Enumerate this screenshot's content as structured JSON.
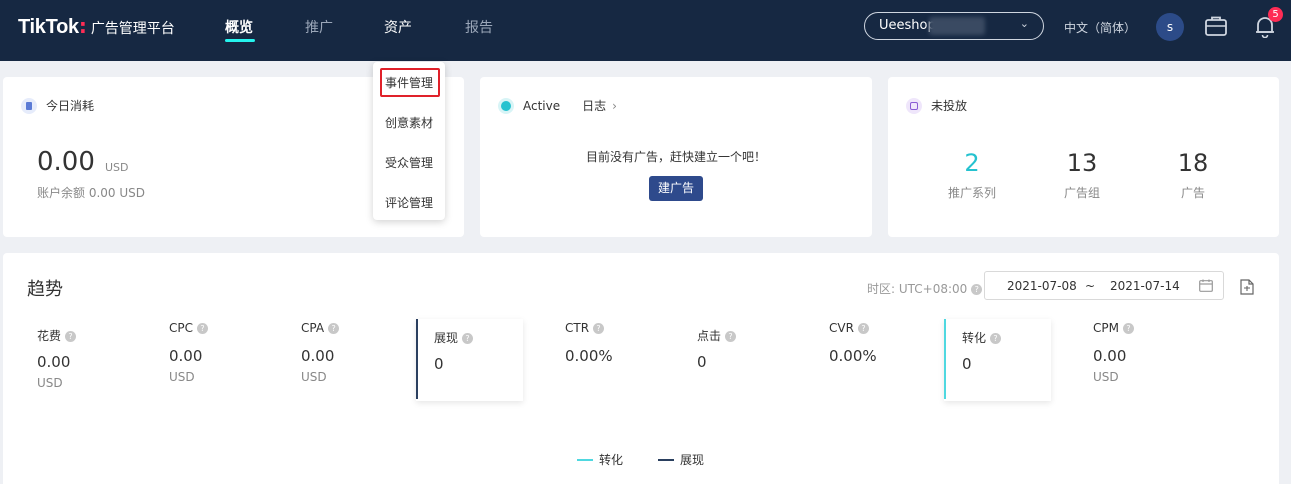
{
  "header": {
    "logo_main": "TikTok",
    "logo_colon": ":",
    "logo_sub": "广告管理平台",
    "nav": [
      "概览",
      "推广",
      "资产",
      "报告"
    ],
    "account": "Ueeshop",
    "language": "中文（简体）",
    "avatar_letter": "s",
    "notification_count": "5"
  },
  "asset_menu": [
    "事件管理",
    "创意素材",
    "受众管理",
    "评论管理"
  ],
  "spend_card": {
    "title": "今日消耗",
    "amount": "0.00",
    "unit": "USD",
    "balance": "账户余额 0.00 USD"
  },
  "status_card": {
    "status": "Active",
    "log_link": "日志",
    "empty_msg": "目前没有广告，赶快建立一个吧！",
    "create_btn": "建广告"
  },
  "undelivered_card": {
    "title": "未投放",
    "stats": [
      {
        "value": "2",
        "label": "推广系列"
      },
      {
        "value": "13",
        "label": "广告组"
      },
      {
        "value": "18",
        "label": "广告"
      }
    ]
  },
  "trend": {
    "title": "趋势",
    "timezone": "时区: UTC+08:00",
    "date_start": "2021-07-08",
    "date_sep": "~",
    "date_end": "2021-07-14",
    "metrics": [
      {
        "label": "花费",
        "value": "0.00",
        "unit": "USD"
      },
      {
        "label": "CPC",
        "value": "0.00",
        "unit": "USD"
      },
      {
        "label": "CPA",
        "value": "0.00",
        "unit": "USD"
      },
      {
        "label": "展现",
        "value": "0",
        "unit": ""
      },
      {
        "label": "CTR",
        "value": "0.00%",
        "unit": ""
      },
      {
        "label": "点击",
        "value": "0",
        "unit": ""
      },
      {
        "label": "CVR",
        "value": "0.00%",
        "unit": ""
      },
      {
        "label": "转化",
        "value": "0",
        "unit": ""
      },
      {
        "label": "CPM",
        "value": "0.00",
        "unit": "USD"
      }
    ],
    "legend": [
      "转化",
      "展现"
    ]
  },
  "colors": {
    "nav_bg": "#162842",
    "accent_cyan": "#25f4ee",
    "brand_red": "#fe2c55",
    "primary_btn": "#2e4a8c",
    "series_conversion": "#4fd8e0",
    "series_impression": "#2a3f5f"
  }
}
